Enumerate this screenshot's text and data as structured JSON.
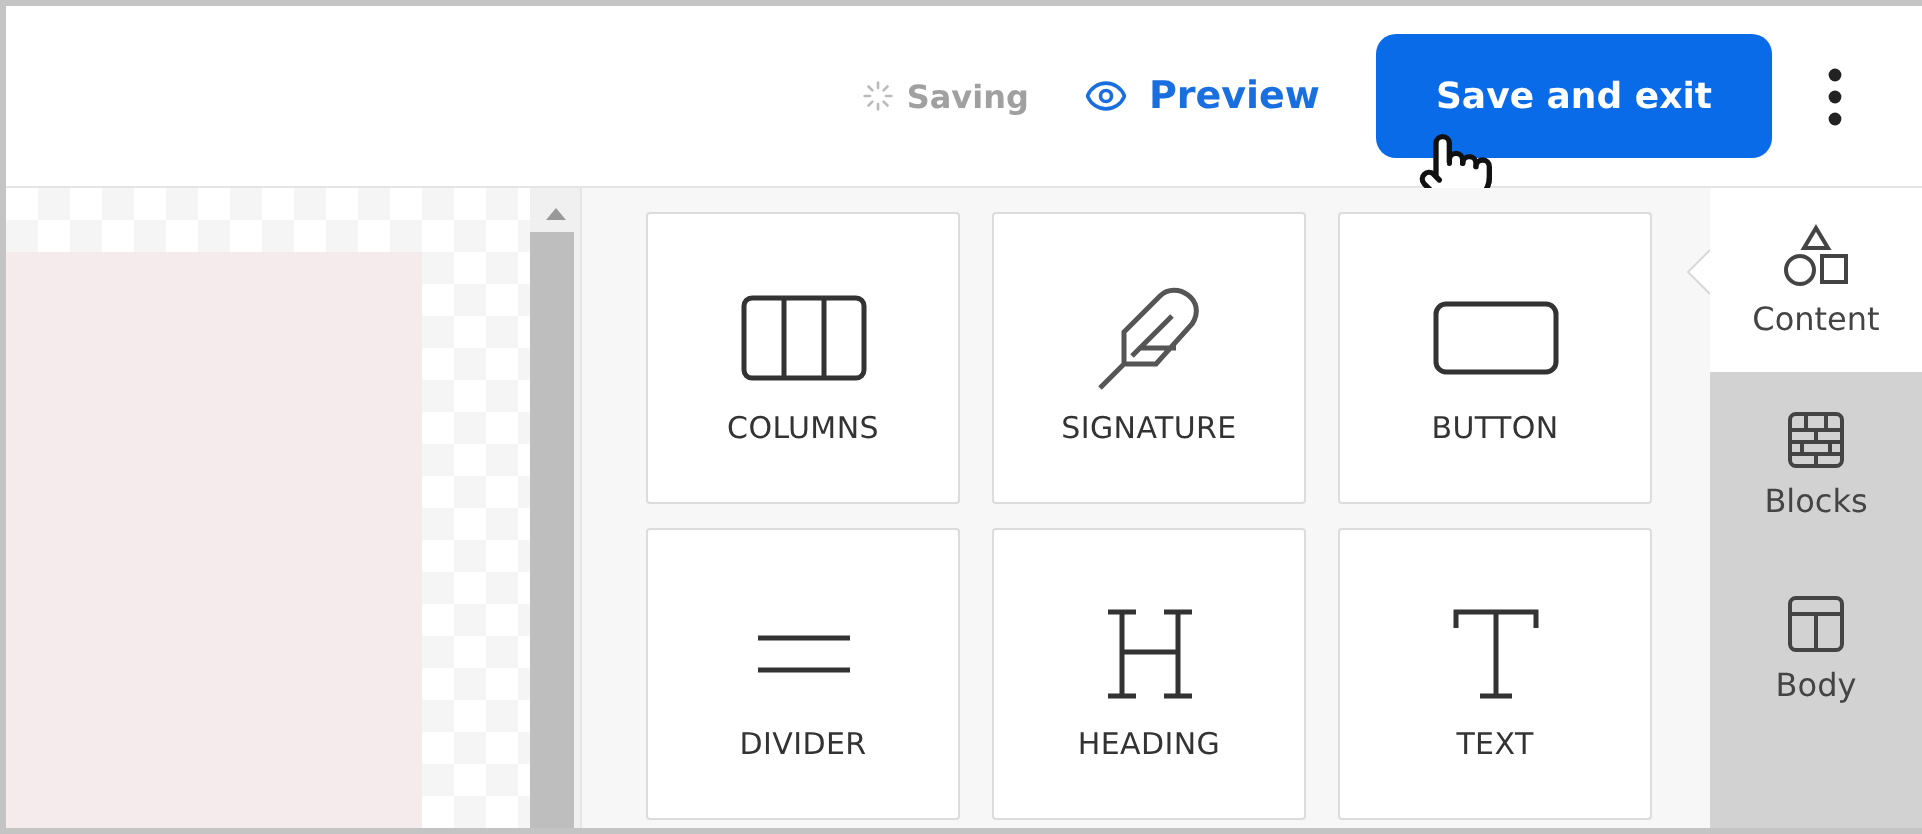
{
  "header": {
    "status": "Saving",
    "preview": "Preview",
    "save_button": "Save and exit"
  },
  "tiles": [
    {
      "kind": "columns",
      "label": "COLUMNS"
    },
    {
      "kind": "signature",
      "label": "SIGNATURE"
    },
    {
      "kind": "button",
      "label": "BUTTON"
    },
    {
      "kind": "divider",
      "label": "DIVIDER"
    },
    {
      "kind": "heading",
      "label": "HEADING"
    },
    {
      "kind": "text",
      "label": "TEXT"
    }
  ],
  "sidebar": {
    "items": [
      {
        "kind": "content",
        "label": "Content",
        "selected": true
      },
      {
        "kind": "blocks",
        "label": "Blocks",
        "selected": false
      },
      {
        "kind": "body",
        "label": "Body",
        "selected": false
      }
    ]
  }
}
